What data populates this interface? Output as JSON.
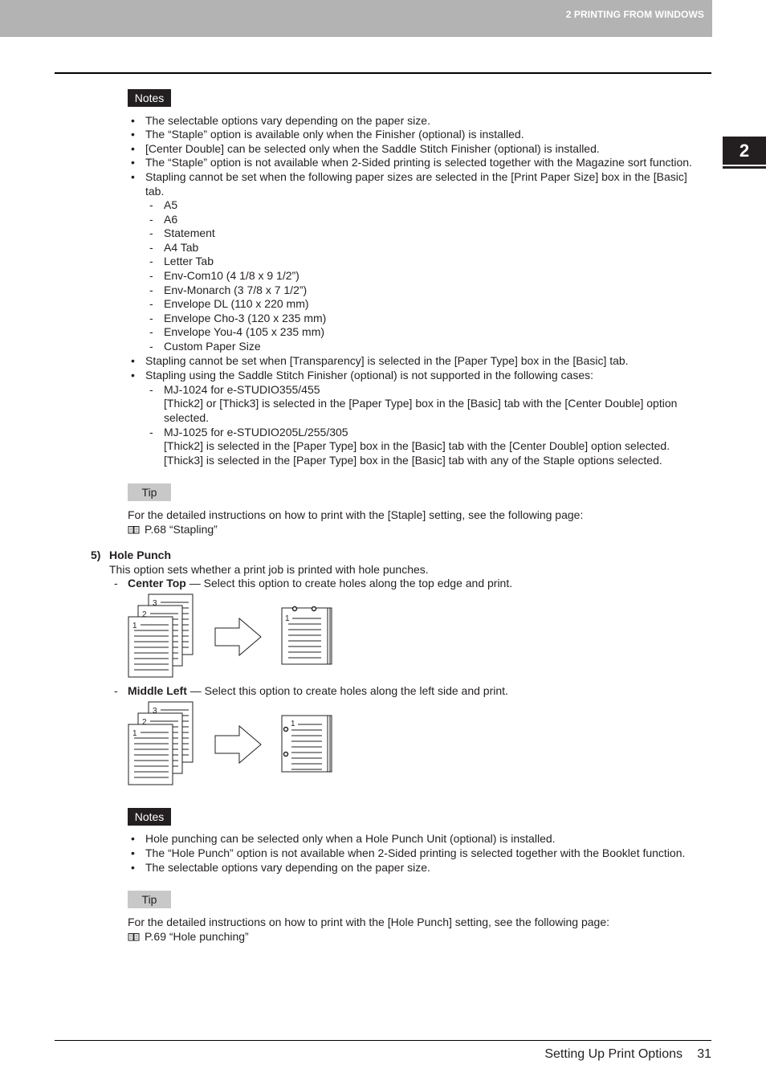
{
  "header": {
    "chapter_title": "2 PRINTING FROM WINDOWS",
    "chapter_tab": "2"
  },
  "notes1": {
    "label": "Notes",
    "bullets": [
      "The selectable options vary depending on the paper size.",
      "The “Staple” option is available only when the Finisher (optional) is installed.",
      "[Center Double] can be selected only when the Saddle Stitch Finisher (optional) is installed.",
      "The “Staple” option is not available when 2-Sided printing is selected together with the Magazine sort function.",
      "Stapling cannot be set when the following paper sizes are selected in the [Print Paper Size] box in the [Basic]",
      "tab."
    ],
    "paper_sizes": [
      "A5",
      "A6",
      "Statement",
      "A4 Tab",
      "Letter Tab",
      "Env-Com10 (4 1/8 x 9 1/2”)",
      "Env-Monarch (3 7/8 x 7 1/2”)",
      "Envelope DL (110 x 220 mm)",
      "Envelope Cho-3 (120 x 235 mm)",
      "Envelope You-4 (105 x 235 mm)",
      "Custom Paper Size"
    ],
    "bullet_transparency": "Stapling cannot be set when [Transparency] is selected in the [Paper Type] box in the [Basic] tab.",
    "bullet_saddle": "Stapling using the Saddle Stitch Finisher (optional) is not supported in the following cases:",
    "cases": [
      {
        "model": "MJ-1024 for e-STUDIO355/455",
        "lines": [
          "[Thick2] or [Thick3] is selected in the [Paper Type] box in the [Basic] tab with the [Center Double] option",
          "selected."
        ]
      },
      {
        "model": "MJ-1025 for e-STUDIO205L/255/305",
        "lines": [
          "[Thick2] is selected in the [Paper Type] box in the [Basic] tab with the [Center Double] option selected.",
          "[Thick3] is selected in the [Paper Type] box in the [Basic] tab with any of the Staple options selected."
        ]
      }
    ]
  },
  "tip1": {
    "label": "Tip",
    "text": "For the detailed instructions on how to print with the [Staple] setting, see the following page:",
    "link": "P.68 “Stapling”"
  },
  "hole_punch": {
    "number": "5)",
    "title": "Hole Punch",
    "description": "This option sets whether a print job is printed with hole punches.",
    "options": [
      {
        "name": "Center Top",
        "desc": " — Select this option to create holes along the top edge and print."
      },
      {
        "name": "Middle Left",
        "desc": " — Select this option to create holes along the left side and print."
      }
    ]
  },
  "notes2": {
    "label": "Notes",
    "bullets": [
      "Hole punching can be selected only when a Hole Punch Unit (optional) is installed.",
      "The “Hole Punch” option is not available when 2-Sided printing is selected together with the Booklet function.",
      "The selectable options vary depending on the paper size."
    ]
  },
  "tip2": {
    "label": "Tip",
    "text": "For the detailed instructions on how to print with the [Hole Punch] setting, see the following page:",
    "link": "P.69 “Hole punching”"
  },
  "footer": {
    "section": "Setting Up Print Options",
    "page": "31"
  },
  "figure_labels": {
    "page1": "1",
    "page2": "2",
    "page3": "3"
  }
}
